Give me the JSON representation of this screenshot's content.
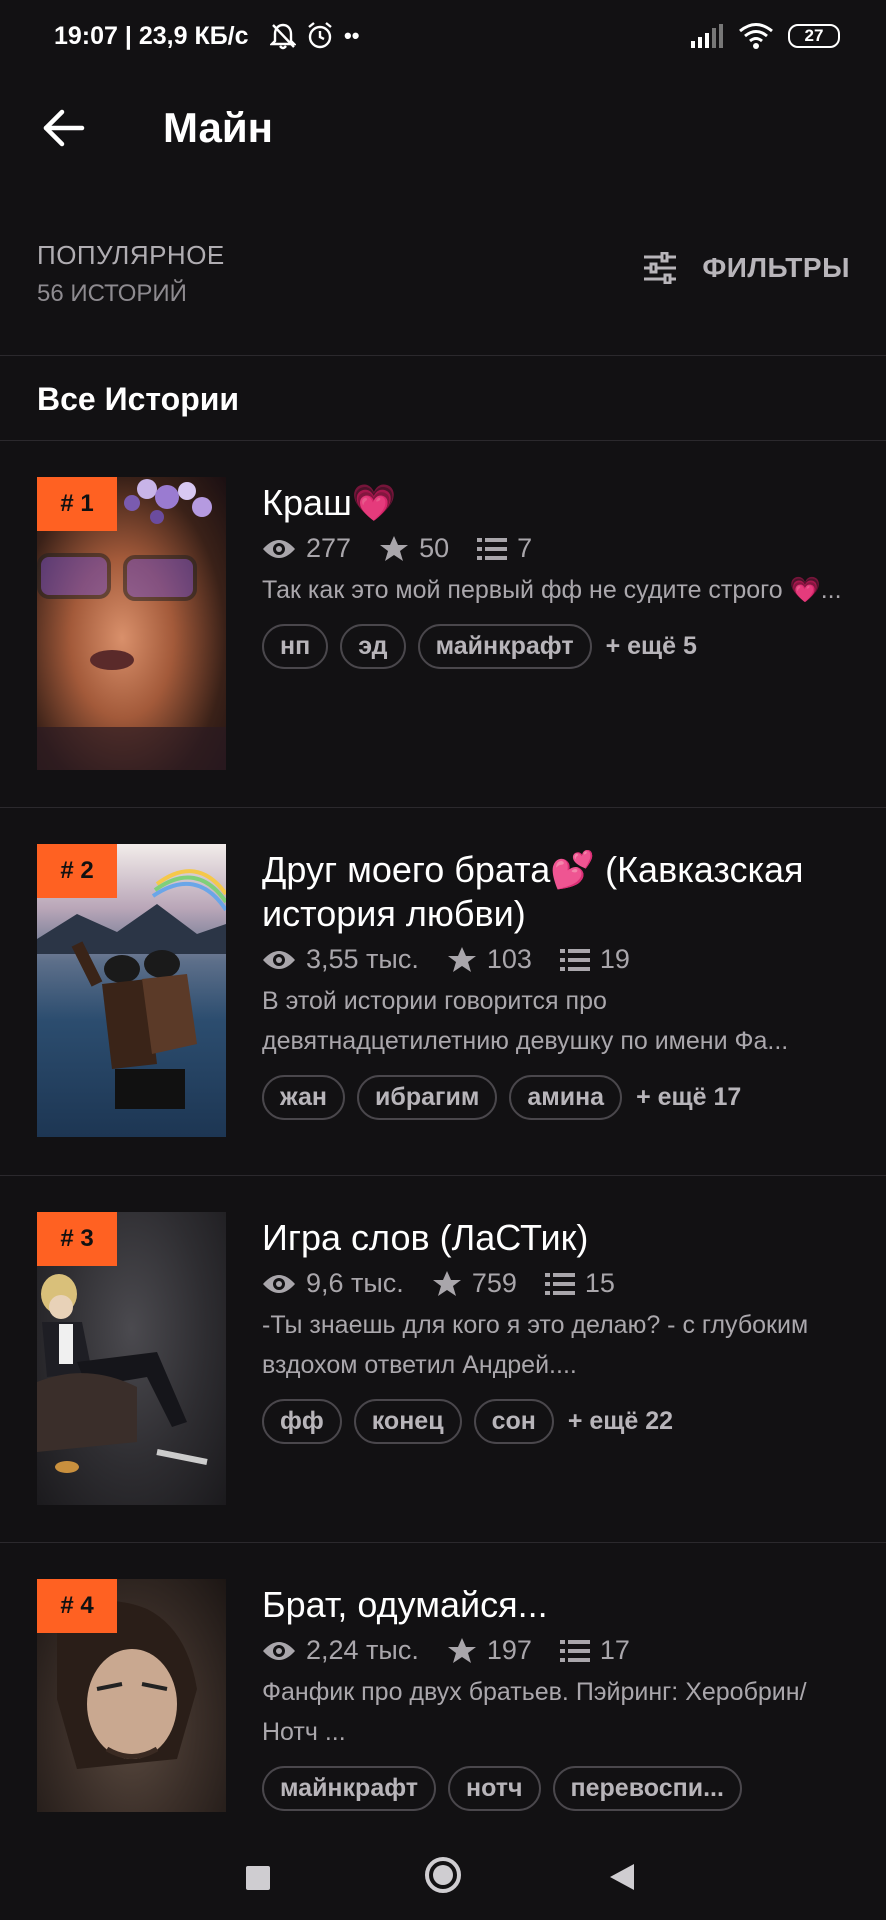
{
  "status_bar": {
    "time": "19:07",
    "network_speed": "| 23,9 КБ/с",
    "battery": "27"
  },
  "header": {
    "title": "Майн"
  },
  "section": {
    "label": "ПОПУЛЯРНОЕ",
    "count": "56 ИСТОРИЙ",
    "filters_label": "ФИЛЬТРЫ",
    "all_stories": "Все Истории"
  },
  "stories": [
    {
      "rank": "# 1",
      "title": "Краш💗",
      "views": "277",
      "stars": "50",
      "chapters": "7",
      "description": "Так как это мой первый фф не судите строго 💗...",
      "tags": [
        "нп",
        "эд",
        "майнкрафт"
      ],
      "more": "+ ещё 5"
    },
    {
      "rank": "# 2",
      "title": "Друг моего брата💕 (Кавказская история любви)",
      "views": "3,55 тыс.",
      "stars": "103",
      "chapters": "19",
      "description": "В этой истории говорится про девятнадцетилетнию девушку по имени Фа...",
      "tags": [
        "жан",
        "ибрагим",
        "амина"
      ],
      "more": "+ ещё 17"
    },
    {
      "rank": "# 3",
      "title": "Игра слов (ЛаСТик)",
      "views": "9,6 тыс.",
      "stars": "759",
      "chapters": "15",
      "description": "-Ты знаешь для кого я это делаю? - с глубоким вздохом ответил Андрей....",
      "tags": [
        "фф",
        "конец",
        "сон"
      ],
      "more": "+ ещё 22"
    },
    {
      "rank": "# 4",
      "title": "Брат, одумайся...",
      "views": "2,24 тыс.",
      "stars": "197",
      "chapters": "17",
      "description": "Фанфик про двух братьев. Пэйринг: Херобрин/Нотч ...",
      "tags": [
        "майнкрафт",
        "нотч",
        "перевоспи..."
      ],
      "more": ""
    }
  ],
  "colors": {
    "background": "#121113",
    "accent": "#ff6122",
    "muted_text": "#aaa7ac"
  }
}
